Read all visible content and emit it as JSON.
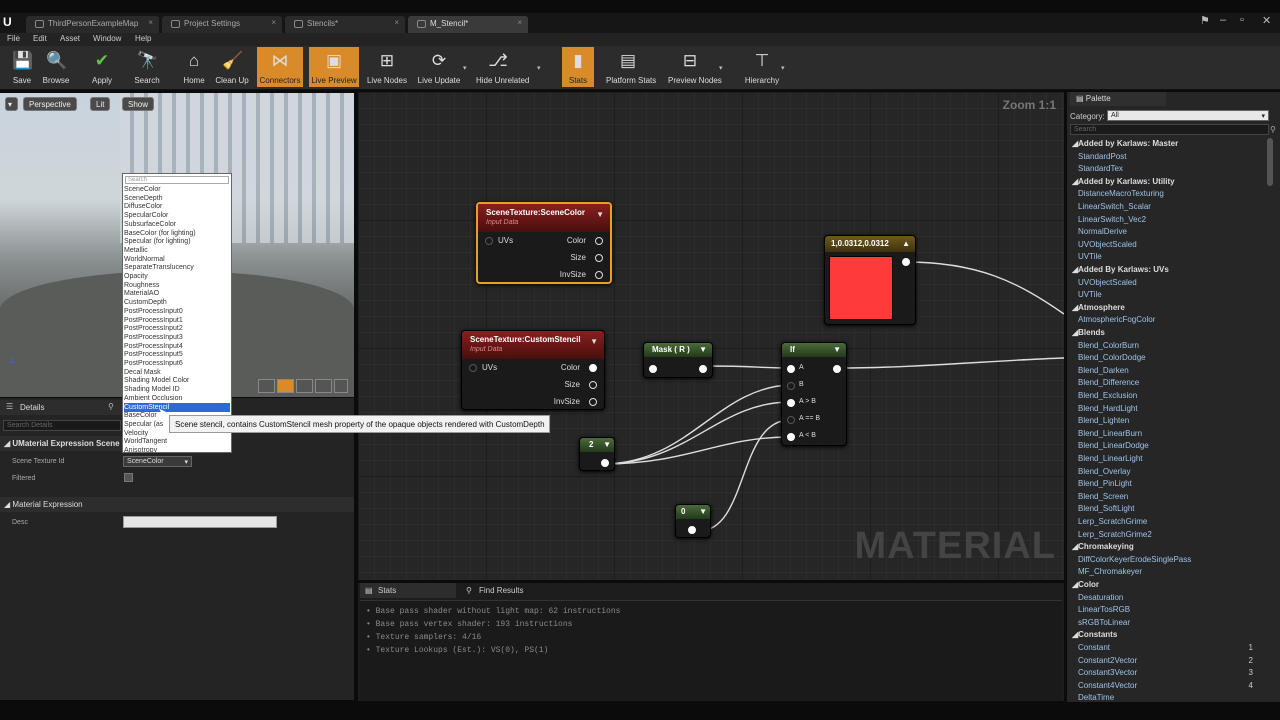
{
  "tabs": [
    {
      "label": "ThirdPersonExampleMap"
    },
    {
      "label": "Project Settings"
    },
    {
      "label": "Stencils*"
    },
    {
      "label": "M_Stencil*"
    }
  ],
  "menu": [
    "File",
    "Edit",
    "Asset",
    "Window",
    "Help"
  ],
  "toolbar": {
    "buttons": [
      {
        "label": "Save",
        "icon": "💾"
      },
      {
        "label": "Browse",
        "icon": "🔍"
      },
      {
        "label": "Apply",
        "icon": "✔"
      },
      {
        "label": "Search",
        "icon": "🔭"
      },
      {
        "label": "Home",
        "icon": "⌂"
      },
      {
        "label": "Clean Up",
        "icon": "🧹"
      },
      {
        "label": "Connectors",
        "icon": "⋈"
      },
      {
        "label": "Live Preview",
        "icon": "▣"
      },
      {
        "label": "Live Nodes",
        "icon": "⊞"
      },
      {
        "label": "Live Update",
        "icon": "⟳"
      },
      {
        "label": "Hide Unrelated",
        "icon": "⎇"
      },
      {
        "label": "Stats",
        "icon": "▮"
      },
      {
        "label": "Platform Stats",
        "icon": "▤"
      },
      {
        "label": "Preview Nodes",
        "icon": "⊟"
      },
      {
        "label": "Hierarchy",
        "icon": "⊤"
      }
    ]
  },
  "viewport": {
    "perspective": "Perspective",
    "lit": "Lit",
    "show": "Show"
  },
  "dropdown": {
    "search_placeholder": "Search",
    "items": [
      "SceneColor",
      "SceneDepth",
      "DiffuseColor",
      "SpecularColor",
      "SubsurfaceColor",
      "BaseColor (for lighting)",
      "Specular (for lighting)",
      "Metallic",
      "WorldNormal",
      "SeparateTranslucency",
      "Opacity",
      "Roughness",
      "MaterialAO",
      "CustomDepth",
      "PostProcessInput0",
      "PostProcessInput1",
      "PostProcessInput2",
      "PostProcessInput3",
      "PostProcessInput4",
      "PostProcessInput5",
      "PostProcessInput6",
      "Decal Mask",
      "Shading Model Color",
      "Shading Model ID",
      "Ambient Occlusion",
      "CustomStencil",
      "BaseColor",
      "Specular (as",
      "Velocity",
      "WorldTangent",
      "Anisotropy"
    ],
    "highlighted": "CustomStencil"
  },
  "tooltip": "Scene stencil, contains CustomStencil mesh property of the opaque objects rendered with CustomDepth",
  "details": {
    "tab": "Details",
    "search_placeholder": "Search Details",
    "section1": "UMaterial Expression Scene",
    "scene_texture_label": "Scene Texture Id",
    "scene_texture_value": "SceneColor",
    "filtered_label": "Filtered",
    "section2": "Material Expression",
    "desc_label": "Desc"
  },
  "graph": {
    "zoom": "Zoom 1:1",
    "watermark": "MATERIAL",
    "node_scenecolor": {
      "title": "SceneTexture:SceneColor",
      "subtitle": "Input Data",
      "in": "UVs",
      "outs": [
        "Color",
        "Size",
        "InvSize"
      ]
    },
    "node_customstencil": {
      "title": "SceneTexture:CustomStencil",
      "subtitle": "Input Data",
      "in": "UVs",
      "outs": [
        "Color",
        "Size",
        "InvSize"
      ]
    },
    "node_mask": {
      "title": "Mask ( R )"
    },
    "node_if": {
      "title": "If",
      "inputs": [
        "A",
        "B",
        "A > B",
        "A == B",
        "A < B"
      ]
    },
    "node_const2": {
      "title": "2"
    },
    "node_const0": {
      "title": "0"
    },
    "node_color": {
      "title": "1,0.0312,0.0312",
      "swatch": "#ff3a3a"
    }
  },
  "stats": {
    "tabs": [
      "Stats",
      "Find Results"
    ],
    "lines": [
      "Base pass shader without light map: 62 instructions",
      "Base pass vertex shader: 193 instructions",
      "Texture samplers: 4/16",
      "Texture Lookups (Est.): VS(0), PS(1)"
    ]
  },
  "palette": {
    "tab": "Palette",
    "category_label": "Category:",
    "category_value": "All",
    "search_placeholder": "Search",
    "entries": [
      {
        "t": "cat",
        "label": "Added by Karlaws: Master"
      },
      {
        "t": "item",
        "label": "StandardPost"
      },
      {
        "t": "item",
        "label": "StandardTex"
      },
      {
        "t": "cat",
        "label": "Added by Karlaws: Utility"
      },
      {
        "t": "item",
        "label": "DistanceMacroTexturing"
      },
      {
        "t": "item",
        "label": "LinearSwitch_Scalar"
      },
      {
        "t": "item",
        "label": "LinearSwitch_Vec2"
      },
      {
        "t": "item",
        "label": "NormalDerive"
      },
      {
        "t": "item",
        "label": "UVObjectScaled"
      },
      {
        "t": "item",
        "label": "UVTile"
      },
      {
        "t": "cat",
        "label": "Added By Karlaws: UVs"
      },
      {
        "t": "item",
        "label": "UVObjectScaled"
      },
      {
        "t": "item",
        "label": "UVTile"
      },
      {
        "t": "cat",
        "label": "Atmosphere"
      },
      {
        "t": "item",
        "label": "AtmosphericFogColor"
      },
      {
        "t": "cat",
        "label": "Blends"
      },
      {
        "t": "item",
        "label": "Blend_ColorBurn"
      },
      {
        "t": "item",
        "label": "Blend_ColorDodge"
      },
      {
        "t": "item",
        "label": "Blend_Darken"
      },
      {
        "t": "item",
        "label": "Blend_Difference"
      },
      {
        "t": "item",
        "label": "Blend_Exclusion"
      },
      {
        "t": "item",
        "label": "Blend_HardLight"
      },
      {
        "t": "item",
        "label": "Blend_Lighten"
      },
      {
        "t": "item",
        "label": "Blend_LinearBurn"
      },
      {
        "t": "item",
        "label": "Blend_LinearDodge"
      },
      {
        "t": "item",
        "label": "Blend_LinearLight"
      },
      {
        "t": "item",
        "label": "Blend_Overlay"
      },
      {
        "t": "item",
        "label": "Blend_PinLight"
      },
      {
        "t": "item",
        "label": "Blend_Screen"
      },
      {
        "t": "item",
        "label": "Blend_SoftLight"
      },
      {
        "t": "item",
        "label": "Lerp_ScratchGrime"
      },
      {
        "t": "item",
        "label": "Lerp_ScratchGrime2"
      },
      {
        "t": "cat",
        "label": "Chromakeying"
      },
      {
        "t": "item",
        "label": "DiffColorKeyerErodeSinglePass"
      },
      {
        "t": "item",
        "label": "MF_Chromakeyer"
      },
      {
        "t": "cat",
        "label": "Color"
      },
      {
        "t": "item",
        "label": "Desaturation"
      },
      {
        "t": "item",
        "label": "LinearTosRGB"
      },
      {
        "t": "item",
        "label": "sRGBToLinear"
      },
      {
        "t": "cat",
        "label": "Constants"
      },
      {
        "t": "item",
        "label": "Constant",
        "num": "1"
      },
      {
        "t": "item",
        "label": "Constant2Vector",
        "num": "2"
      },
      {
        "t": "item",
        "label": "Constant3Vector",
        "num": "3"
      },
      {
        "t": "item",
        "label": "Constant4Vector",
        "num": "4"
      },
      {
        "t": "item",
        "label": "DeltaTime"
      }
    ]
  }
}
